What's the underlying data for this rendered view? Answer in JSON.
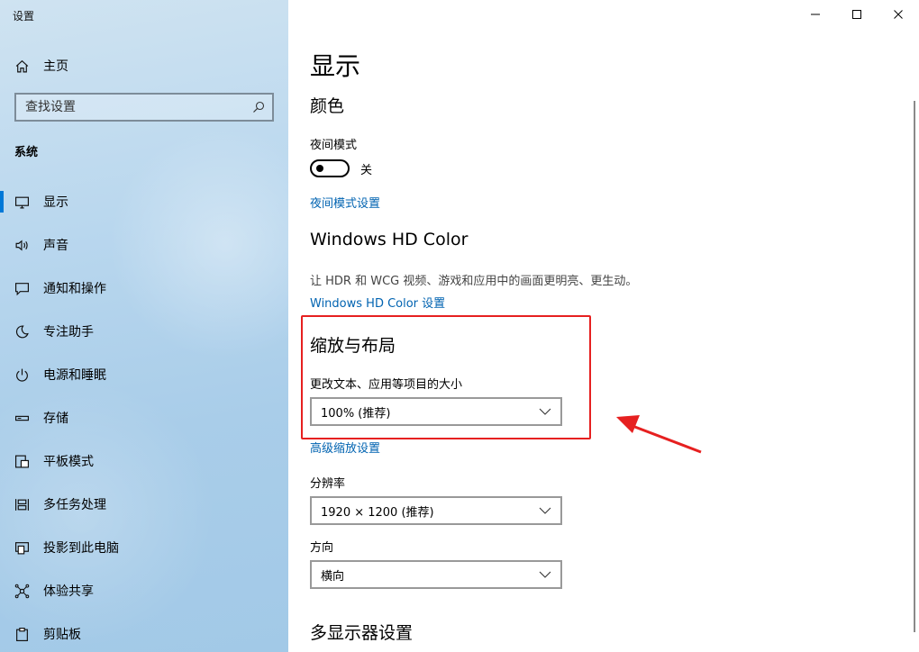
{
  "window": {
    "title": "设置"
  },
  "sidebar": {
    "home_label": "主页",
    "search_placeholder": "查找设置",
    "section_label": "系统",
    "items": [
      {
        "label": "显示",
        "icon": "monitor-icon",
        "active": true
      },
      {
        "label": "声音",
        "icon": "speaker-icon"
      },
      {
        "label": "通知和操作",
        "icon": "notification-icon"
      },
      {
        "label": "专注助手",
        "icon": "moon-icon"
      },
      {
        "label": "电源和睡眠",
        "icon": "power-icon"
      },
      {
        "label": "存储",
        "icon": "storage-icon"
      },
      {
        "label": "平板模式",
        "icon": "tablet-mode-icon"
      },
      {
        "label": "多任务处理",
        "icon": "multitasking-icon"
      },
      {
        "label": "投影到此电脑",
        "icon": "project-icon"
      },
      {
        "label": "体验共享",
        "icon": "shared-experience-icon"
      },
      {
        "label": "剪贴板",
        "icon": "clipboard-icon"
      }
    ]
  },
  "main": {
    "page_title": "显示",
    "color": {
      "heading": "颜色",
      "night_mode_label": "夜间模式",
      "night_mode_state": "关",
      "night_mode_link": "夜间模式设置"
    },
    "hdr": {
      "heading": "Windows HD Color",
      "description": "让 HDR 和 WCG 视频、游戏和应用中的画面更明亮、更生动。",
      "link": "Windows HD Color 设置"
    },
    "scale": {
      "heading": "缩放与布局",
      "size_label": "更改文本、应用等项目的大小",
      "size_value": "100% (推荐)",
      "advanced_link": "高级缩放设置",
      "resolution_label": "分辨率",
      "resolution_value": "1920 × 1200 (推荐)",
      "orientation_label": "方向",
      "orientation_value": "横向"
    },
    "multi_display_heading": "多显示器设置"
  },
  "colors": {
    "accent": "#0078d7",
    "link": "#0063b1",
    "highlight": "#e62020"
  }
}
